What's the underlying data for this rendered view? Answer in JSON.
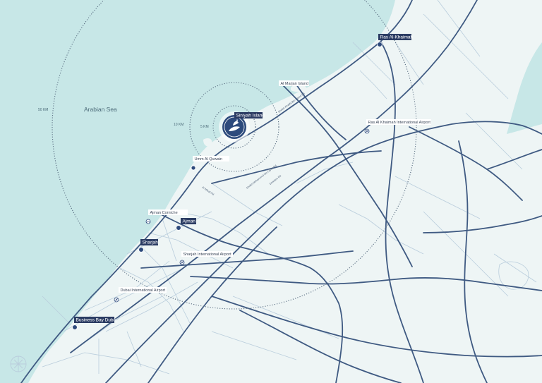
{
  "map": {
    "sea_label": "Arabian Sea",
    "radii": {
      "r50": "50 KM",
      "r10": "10 KM",
      "r5": "5 KM"
    },
    "featured": "Siniyah Island",
    "cities": {
      "ras_al_khaimah": "Ras Al-Khaimah",
      "ajman": "Ajman",
      "sharjah": "Sharjah",
      "business_bay": "Business Bay Dubai"
    },
    "places": {
      "al_marjan": "Al Marjan Island",
      "umm_al_quwain": "Umm Al Quwain",
      "ajman_corniche": "Ajman Corniche",
      "sharjah_airport": "Sharjah International Airport",
      "dubai_airport": "Dubai International Airport",
      "rak_airport": "Ras Al Khaimah International Airport"
    },
    "roads": {
      "e311": "Sheikh Mohammed bin Zayed Rd",
      "e611": "Emirates Rd",
      "e11": "Al Ittihad Rd",
      "coastal": "Sheikh Khalifa Bin Zayed Rd"
    },
    "colors": {
      "sea": "#c7e7e7",
      "land": "#eef5f5",
      "road": "#3f5a82",
      "minor_road": "#b9cddc",
      "city_pin": "#2d4a7c",
      "label_bg": "#2b3c63",
      "ring": "#5a6e82"
    }
  }
}
